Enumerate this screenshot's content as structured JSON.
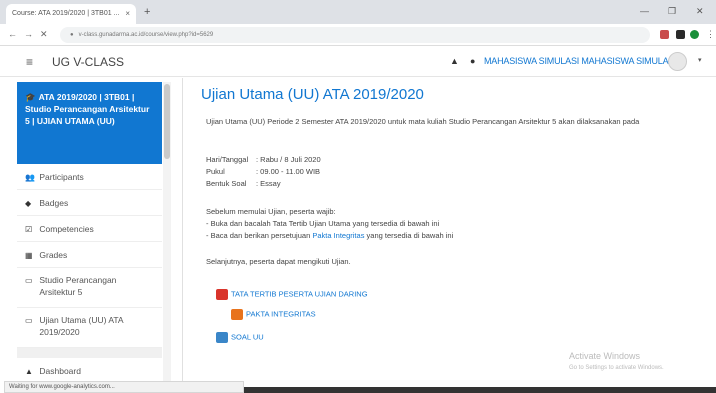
{
  "browser": {
    "tab_title": "Course: ATA 2019/2020 | 3TB01 ...",
    "tab_close": "×",
    "new_tab": "+",
    "window_min": "—",
    "window_max": "❐",
    "window_close": "✕",
    "back": "←",
    "forward": "→",
    "reload": "✕",
    "url": "v-class.gunadarma.ac.id/course/view.php?id=5629",
    "status_text": "Waiting for www.google-analytics.com..."
  },
  "header": {
    "menu_icon": "≡",
    "brand": "UG V-CLASS",
    "bell_icon": "▲",
    "chat_icon": "●",
    "username": "MAHASISWA SIMULASI MAHASISWA SIMULASI",
    "caret": "▾"
  },
  "sidebar": {
    "active_item": "ATA 2019/2020 | 3TB01 | Studio Perancangan Arsitektur 5 | UJIAN UTAMA (UU)",
    "active_icon": "🎓",
    "items": [
      {
        "icon": "👥",
        "label": "Participants"
      },
      {
        "icon": "◆",
        "label": "Badges"
      },
      {
        "icon": "☑",
        "label": "Competencies"
      },
      {
        "icon": "▦",
        "label": "Grades"
      },
      {
        "icon": "▭",
        "label": "Studio Perancangan Arsitektur 5"
      },
      {
        "icon": "▭",
        "label": "Ujian Utama (UU) ATA 2019/2020"
      },
      {
        "icon": "▲",
        "label": "Dashboard"
      }
    ]
  },
  "main": {
    "title": "Ujian Utama (UU) ATA 2019/2020",
    "intro": "Ujian Utama (UU) Periode 2 Semester ATA 2019/2020 untuk mata kuliah Studio Perancangan Arsitektur 5 akan dilaksanakan pada",
    "schedule": [
      {
        "key": "Hari/Tanggal",
        "value": ": Rabu / 8 Juli 2020"
      },
      {
        "key": "Pukul",
        "value": ": 09.00 - 11.00 WIB"
      },
      {
        "key": "Bentuk Soal",
        "value": ": Essay"
      }
    ],
    "before_heading": "Sebelum memulai Ujian, peserta wajib:",
    "step1": "- Buka dan bacalah Tata Tertib Ujian Utama yang tersedia di bawah ini",
    "step2_pre": "- Baca dan berikan persetujuan ",
    "step2_link": "Pakta Integritas",
    "step2_post": " yang tersedia di bawah ini",
    "next_text": "Selanjutnya, peserta dapat mengikuti Ujian.",
    "resources": [
      {
        "label": "TATA TERTIB PESERTA UJIAN DARING",
        "icon": "pdf-icon",
        "color": "#d9342b"
      },
      {
        "label": "PAKTA INTEGRITAS",
        "icon": "feedback-icon",
        "color": "#e8731c"
      },
      {
        "label": "SOAL UU",
        "icon": "assignment-icon",
        "color": "#3a86c8"
      }
    ],
    "watermark_title": "Activate Windows",
    "watermark_sub": "Go to Settings to activate Windows."
  }
}
